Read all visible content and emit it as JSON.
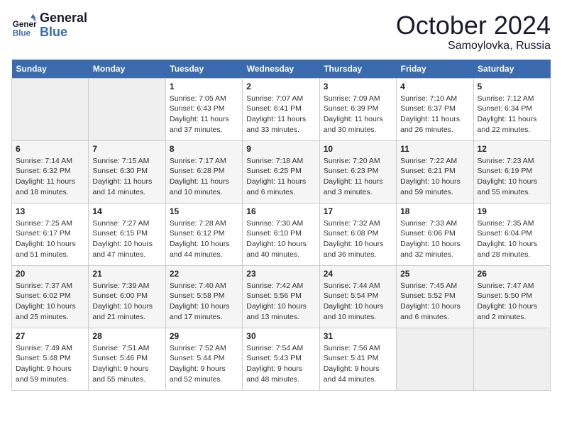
{
  "header": {
    "logo_line1": "General",
    "logo_line2": "Blue",
    "month": "October 2024",
    "location": "Samoylovka, Russia"
  },
  "weekdays": [
    "Sunday",
    "Monday",
    "Tuesday",
    "Wednesday",
    "Thursday",
    "Friday",
    "Saturday"
  ],
  "weeks": [
    [
      {
        "day": "",
        "empty": true
      },
      {
        "day": "",
        "empty": true
      },
      {
        "day": "1",
        "sunrise": "Sunrise: 7:05 AM",
        "sunset": "Sunset: 6:43 PM",
        "daylight": "Daylight: 11 hours and 37 minutes."
      },
      {
        "day": "2",
        "sunrise": "Sunrise: 7:07 AM",
        "sunset": "Sunset: 6:41 PM",
        "daylight": "Daylight: 11 hours and 33 minutes."
      },
      {
        "day": "3",
        "sunrise": "Sunrise: 7:09 AM",
        "sunset": "Sunset: 6:39 PM",
        "daylight": "Daylight: 11 hours and 30 minutes."
      },
      {
        "day": "4",
        "sunrise": "Sunrise: 7:10 AM",
        "sunset": "Sunset: 6:37 PM",
        "daylight": "Daylight: 11 hours and 26 minutes."
      },
      {
        "day": "5",
        "sunrise": "Sunrise: 7:12 AM",
        "sunset": "Sunset: 6:34 PM",
        "daylight": "Daylight: 11 hours and 22 minutes."
      }
    ],
    [
      {
        "day": "6",
        "sunrise": "Sunrise: 7:14 AM",
        "sunset": "Sunset: 6:32 PM",
        "daylight": "Daylight: 11 hours and 18 minutes."
      },
      {
        "day": "7",
        "sunrise": "Sunrise: 7:15 AM",
        "sunset": "Sunset: 6:30 PM",
        "daylight": "Daylight: 11 hours and 14 minutes."
      },
      {
        "day": "8",
        "sunrise": "Sunrise: 7:17 AM",
        "sunset": "Sunset: 6:28 PM",
        "daylight": "Daylight: 11 hours and 10 minutes."
      },
      {
        "day": "9",
        "sunrise": "Sunrise: 7:18 AM",
        "sunset": "Sunset: 6:25 PM",
        "daylight": "Daylight: 11 hours and 6 minutes."
      },
      {
        "day": "10",
        "sunrise": "Sunrise: 7:20 AM",
        "sunset": "Sunset: 6:23 PM",
        "daylight": "Daylight: 11 hours and 3 minutes."
      },
      {
        "day": "11",
        "sunrise": "Sunrise: 7:22 AM",
        "sunset": "Sunset: 6:21 PM",
        "daylight": "Daylight: 10 hours and 59 minutes."
      },
      {
        "day": "12",
        "sunrise": "Sunrise: 7:23 AM",
        "sunset": "Sunset: 6:19 PM",
        "daylight": "Daylight: 10 hours and 55 minutes."
      }
    ],
    [
      {
        "day": "13",
        "sunrise": "Sunrise: 7:25 AM",
        "sunset": "Sunset: 6:17 PM",
        "daylight": "Daylight: 10 hours and 51 minutes."
      },
      {
        "day": "14",
        "sunrise": "Sunrise: 7:27 AM",
        "sunset": "Sunset: 6:15 PM",
        "daylight": "Daylight: 10 hours and 47 minutes."
      },
      {
        "day": "15",
        "sunrise": "Sunrise: 7:28 AM",
        "sunset": "Sunset: 6:12 PM",
        "daylight": "Daylight: 10 hours and 44 minutes."
      },
      {
        "day": "16",
        "sunrise": "Sunrise: 7:30 AM",
        "sunset": "Sunset: 6:10 PM",
        "daylight": "Daylight: 10 hours and 40 minutes."
      },
      {
        "day": "17",
        "sunrise": "Sunrise: 7:32 AM",
        "sunset": "Sunset: 6:08 PM",
        "daylight": "Daylight: 10 hours and 36 minutes."
      },
      {
        "day": "18",
        "sunrise": "Sunrise: 7:33 AM",
        "sunset": "Sunset: 6:06 PM",
        "daylight": "Daylight: 10 hours and 32 minutes."
      },
      {
        "day": "19",
        "sunrise": "Sunrise: 7:35 AM",
        "sunset": "Sunset: 6:04 PM",
        "daylight": "Daylight: 10 hours and 28 minutes."
      }
    ],
    [
      {
        "day": "20",
        "sunrise": "Sunrise: 7:37 AM",
        "sunset": "Sunset: 6:02 PM",
        "daylight": "Daylight: 10 hours and 25 minutes."
      },
      {
        "day": "21",
        "sunrise": "Sunrise: 7:39 AM",
        "sunset": "Sunset: 6:00 PM",
        "daylight": "Daylight: 10 hours and 21 minutes."
      },
      {
        "day": "22",
        "sunrise": "Sunrise: 7:40 AM",
        "sunset": "Sunset: 5:58 PM",
        "daylight": "Daylight: 10 hours and 17 minutes."
      },
      {
        "day": "23",
        "sunrise": "Sunrise: 7:42 AM",
        "sunset": "Sunset: 5:56 PM",
        "daylight": "Daylight: 10 hours and 13 minutes."
      },
      {
        "day": "24",
        "sunrise": "Sunrise: 7:44 AM",
        "sunset": "Sunset: 5:54 PM",
        "daylight": "Daylight: 10 hours and 10 minutes."
      },
      {
        "day": "25",
        "sunrise": "Sunrise: 7:45 AM",
        "sunset": "Sunset: 5:52 PM",
        "daylight": "Daylight: 10 hours and 6 minutes."
      },
      {
        "day": "26",
        "sunrise": "Sunrise: 7:47 AM",
        "sunset": "Sunset: 5:50 PM",
        "daylight": "Daylight: 10 hours and 2 minutes."
      }
    ],
    [
      {
        "day": "27",
        "sunrise": "Sunrise: 7:49 AM",
        "sunset": "Sunset: 5:48 PM",
        "daylight": "Daylight: 9 hours and 59 minutes."
      },
      {
        "day": "28",
        "sunrise": "Sunrise: 7:51 AM",
        "sunset": "Sunset: 5:46 PM",
        "daylight": "Daylight: 9 hours and 55 minutes."
      },
      {
        "day": "29",
        "sunrise": "Sunrise: 7:52 AM",
        "sunset": "Sunset: 5:44 PM",
        "daylight": "Daylight: 9 hours and 52 minutes."
      },
      {
        "day": "30",
        "sunrise": "Sunrise: 7:54 AM",
        "sunset": "Sunset: 5:43 PM",
        "daylight": "Daylight: 9 hours and 48 minutes."
      },
      {
        "day": "31",
        "sunrise": "Sunrise: 7:56 AM",
        "sunset": "Sunset: 5:41 PM",
        "daylight": "Daylight: 9 hours and 44 minutes."
      },
      {
        "day": "",
        "empty": true
      },
      {
        "day": "",
        "empty": true
      }
    ]
  ]
}
